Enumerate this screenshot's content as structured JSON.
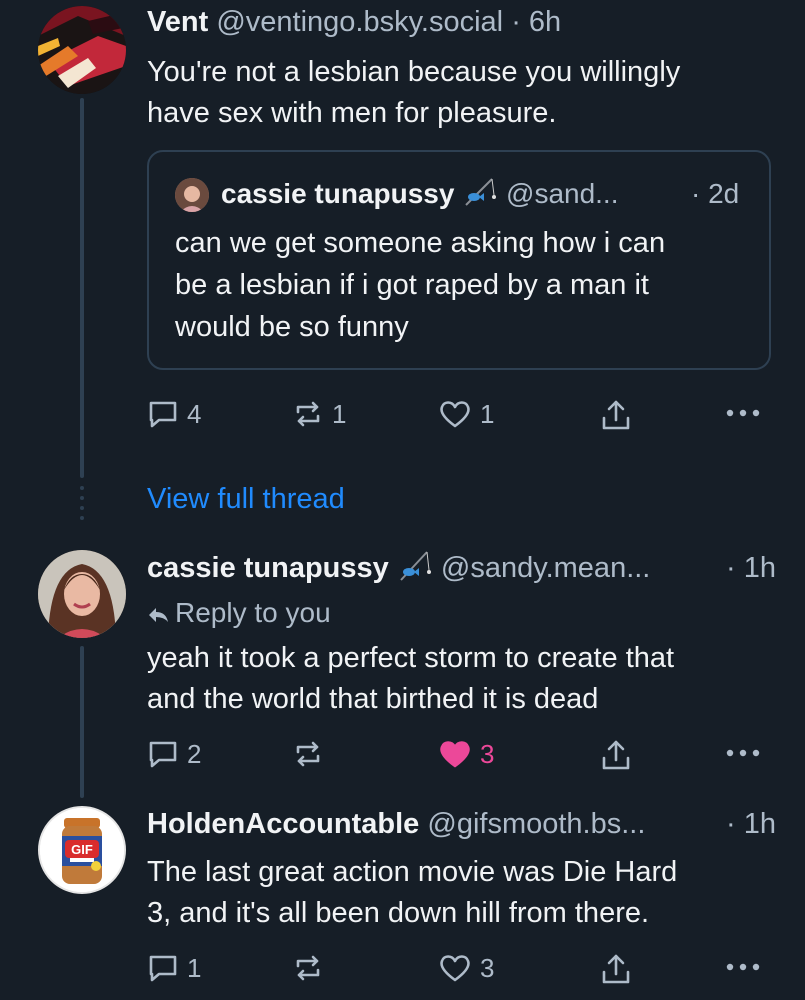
{
  "colors": {
    "background": "#161e27",
    "text": "#f1f3f5",
    "muted": "#aebbc9",
    "link": "#208bfe",
    "like_active": "#ec4899",
    "border": "#2e4052"
  },
  "posts": [
    {
      "author": "Vent",
      "handle": "@ventingo.bsky.social",
      "time": "· 6h",
      "text_lines": [
        "You're not a lesbian because you willingly",
        "have sex with men for pleasure."
      ],
      "quote": {
        "author": "cassie tunapussy",
        "author_emoji": "fishing-pole-icon",
        "handle": "@sand...",
        "time": "· 2d",
        "text_lines": [
          "can we get someone asking how i can",
          "be a lesbian if i got raped by a man it",
          "would be so funny"
        ]
      },
      "actions": {
        "replies": "4",
        "reposts": "1",
        "likes": "1",
        "liked": false
      }
    },
    {
      "author": "cassie tunapussy",
      "author_emoji": "fishing-pole-icon",
      "handle": "@sandy.mean...",
      "time": "· 1h",
      "reply_to": "Reply to you",
      "text_lines": [
        "yeah it took a perfect storm to create that",
        "and the world that birthed it is dead"
      ],
      "actions": {
        "replies": "2",
        "reposts": "",
        "likes": "3",
        "liked": true
      }
    },
    {
      "author": "HoldenAccountable",
      "handle": "@gifsmooth.bs...",
      "time": "· 1h",
      "text_lines": [
        "The last great action movie was Die Hard",
        "3, and it's all been down hill from there."
      ],
      "actions": {
        "replies": "1",
        "reposts": "",
        "likes": "3",
        "liked": false
      }
    }
  ],
  "view_full_thread": "View full thread",
  "avatar_logo_text": "GIF"
}
